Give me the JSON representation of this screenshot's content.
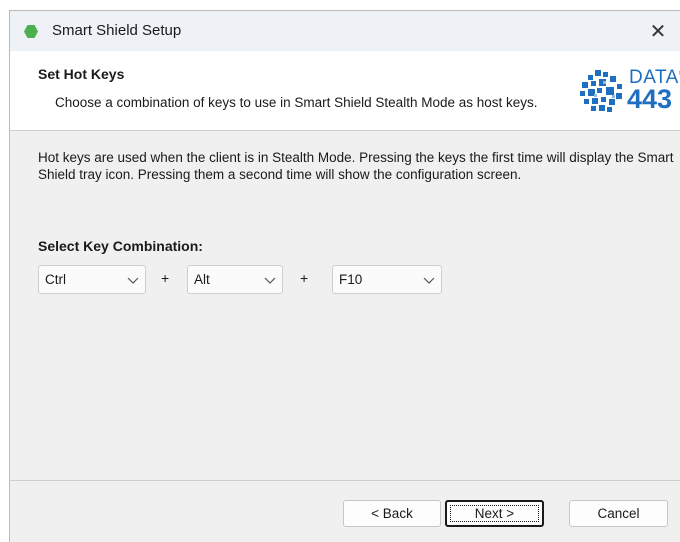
{
  "window": {
    "title": "Smart Shield Setup",
    "close_glyph": "✕"
  },
  "header": {
    "title": "Set Hot Keys",
    "subtitle": "Choose a combination of keys to use in Smart Shield Stealth Mode as host keys.",
    "logo": {
      "word": "DATA",
      "trademark": "®",
      "number": "443"
    }
  },
  "body": {
    "description": "Hot keys are used when the client is in Stealth Mode. Pressing the keys the first time will display the Smart Shield tray icon. Pressing them a second time will show the configuration screen.",
    "select_label": "Select Key Combination:",
    "key1": "Ctrl",
    "plus1": "+",
    "key2": "Alt",
    "plus2": "+",
    "key3": "F10"
  },
  "buttons": {
    "back": "< Back",
    "next": "Next >",
    "cancel": "Cancel"
  },
  "colors": {
    "accent": "#1f6fc1",
    "app_icon": "#4caf50"
  }
}
